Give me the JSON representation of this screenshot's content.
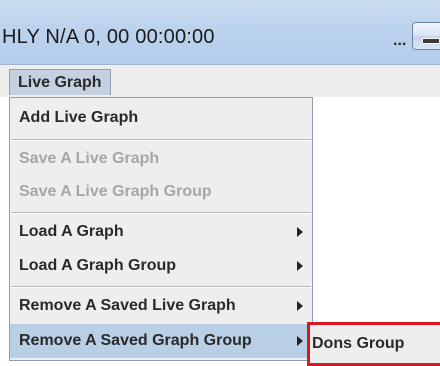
{
  "window": {
    "title": "HLY N/A 0, 00  00:00:00",
    "overflow_indicator": "..."
  },
  "menubar": {
    "menu_label": "Live Graph"
  },
  "menu": {
    "items": [
      {
        "label": "Add Live Graph",
        "enabled": true,
        "has_submenu": false
      },
      {
        "label": "Save A Live Graph",
        "enabled": false,
        "has_submenu": false
      },
      {
        "label": "Save A Live Graph Group",
        "enabled": false,
        "has_submenu": false
      },
      {
        "label": "Load A Graph",
        "enabled": true,
        "has_submenu": true
      },
      {
        "label": "Load A Graph Group",
        "enabled": true,
        "has_submenu": true
      },
      {
        "label": "Remove A Saved Live Graph",
        "enabled": true,
        "has_submenu": true
      },
      {
        "label": "Remove A Saved Graph Group",
        "enabled": true,
        "has_submenu": true,
        "selected": true
      }
    ]
  },
  "submenu": {
    "items": [
      {
        "label": "Dons Group"
      }
    ],
    "highlight_color": "#d7191f"
  },
  "colors": {
    "titlebar": "#bcd3ee",
    "menu_background": "#eeeeee",
    "selected_item": "#b8cfe5",
    "disabled_text": "#a6a6a6"
  }
}
